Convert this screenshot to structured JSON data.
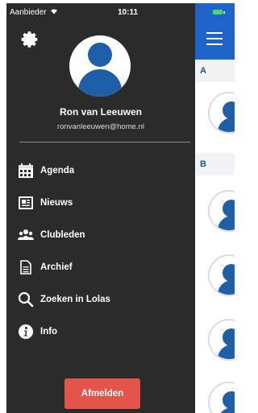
{
  "status_bar": {
    "carrier": "Aanbieder",
    "time": "10:11"
  },
  "drawer": {
    "profile": {
      "name": "Ron van Leeuwen",
      "email": "ronvanleeuwen@home.nl"
    },
    "menu": [
      {
        "label": "Agenda",
        "icon": "calendar-icon"
      },
      {
        "label": "Nieuws",
        "icon": "newspaper-icon"
      },
      {
        "label": "Clubleden",
        "icon": "members-icon"
      },
      {
        "label": "Archief",
        "icon": "document-icon"
      },
      {
        "label": "Zoeken in Lolas",
        "icon": "search-icon"
      },
      {
        "label": "Info",
        "icon": "info-icon"
      }
    ],
    "logout_label": "Afmelden"
  },
  "background": {
    "sections": [
      "A",
      "B"
    ]
  },
  "colors": {
    "drawer_bg": "#2b2b2b",
    "accent": "#1d63c9",
    "logout": "#e4544a"
  }
}
